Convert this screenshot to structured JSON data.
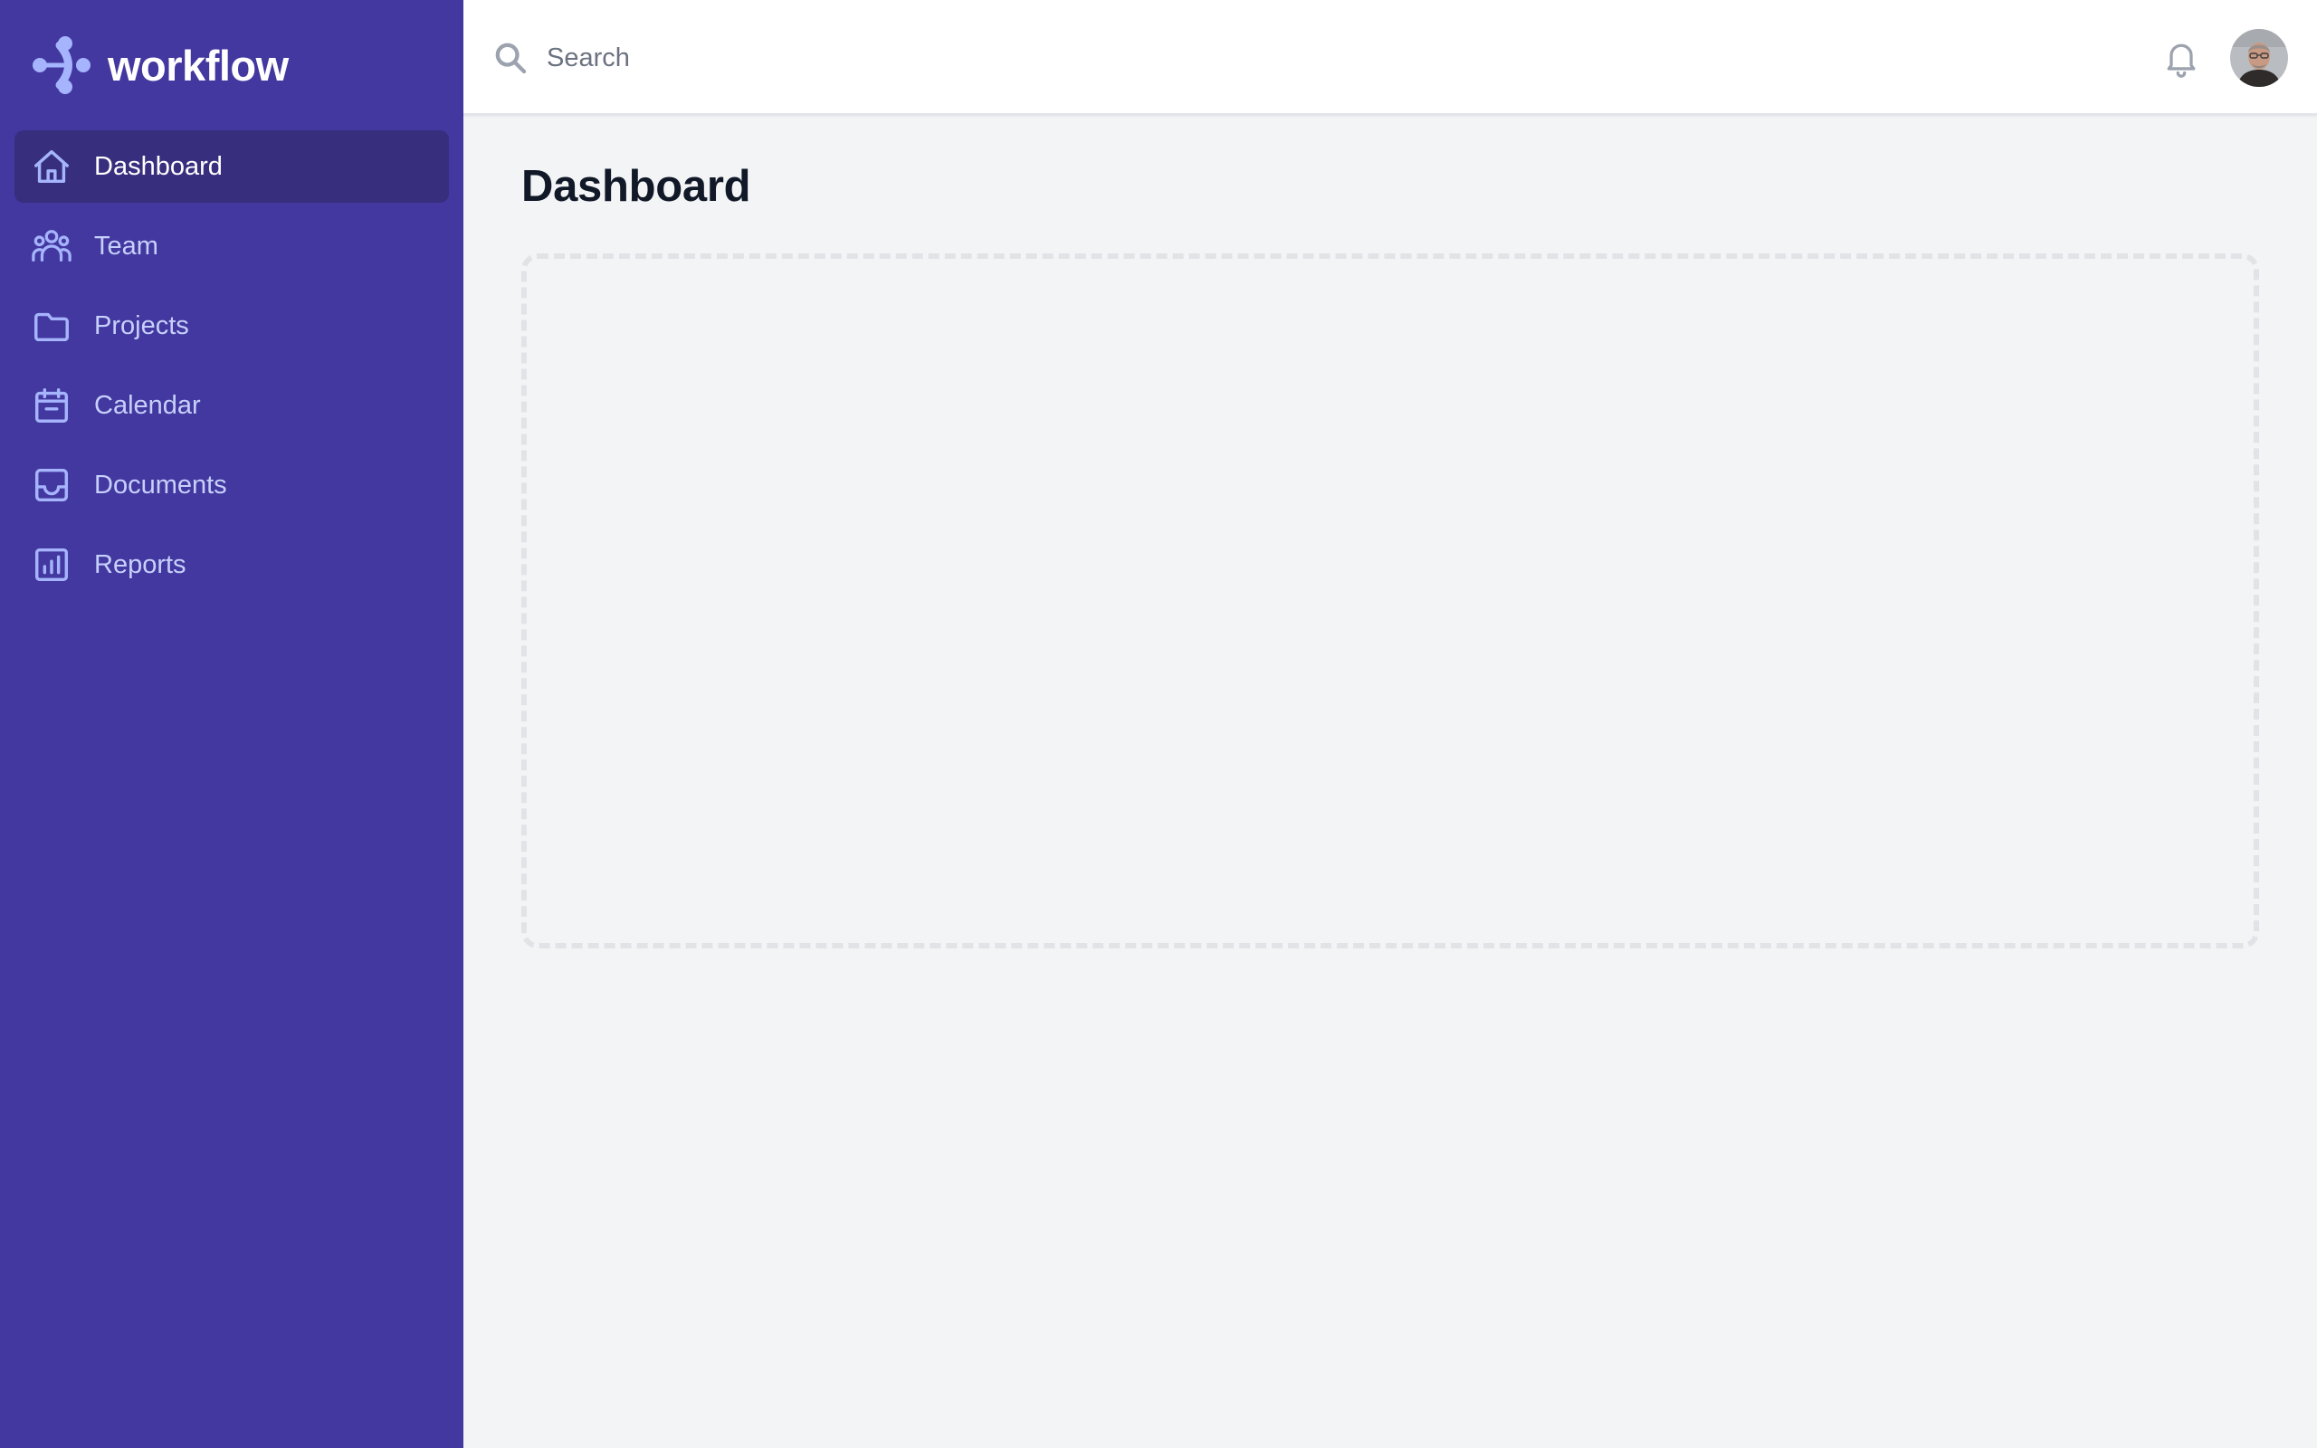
{
  "brand": {
    "name": "workflow",
    "logo_icon": "workflow-logo-icon"
  },
  "sidebar": {
    "items": [
      {
        "label": "Dashboard",
        "icon": "home-icon",
        "active": true
      },
      {
        "label": "Team",
        "icon": "users-icon",
        "active": false
      },
      {
        "label": "Projects",
        "icon": "folder-icon",
        "active": false
      },
      {
        "label": "Calendar",
        "icon": "calendar-icon",
        "active": false
      },
      {
        "label": "Documents",
        "icon": "inbox-icon",
        "active": false
      },
      {
        "label": "Reports",
        "icon": "chart-bar-icon",
        "active": false
      }
    ]
  },
  "topbar": {
    "search": {
      "placeholder": "Search",
      "value": ""
    },
    "notifications_icon": "bell-icon",
    "avatar": "user-avatar"
  },
  "main": {
    "title": "Dashboard"
  },
  "colors": {
    "sidebar_bg": "#4338a0",
    "sidebar_active_bg": "#372f7e",
    "nav_text": "#c7d0fb",
    "icon_accent": "#a5b4fc",
    "page_bg": "#f3f4f6"
  }
}
